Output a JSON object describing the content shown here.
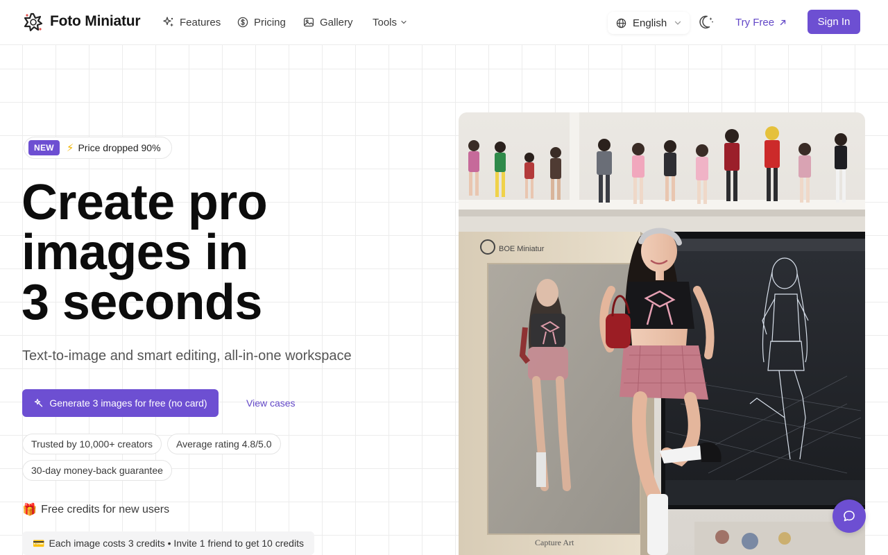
{
  "header": {
    "brand": "Foto Miniatur",
    "nav": [
      {
        "label": "Features",
        "icon": "sparkles-icon"
      },
      {
        "label": "Pricing",
        "icon": "dollar-circle-icon"
      },
      {
        "label": "Gallery",
        "icon": "image-icon"
      },
      {
        "label": "Tools",
        "icon": "chevron-down-icon"
      }
    ],
    "language": "English",
    "try_free": "Try Free",
    "sign_in": "Sign In"
  },
  "hero": {
    "badge_new": "NEW",
    "badge_bolt": "⚡",
    "badge_text": "Price dropped 90%",
    "title_lines": [
      "Create pro",
      "images in",
      "3 seconds"
    ],
    "subtitle": "Text-to-image and smart editing, all-in-one workspace",
    "cta": "Generate 3 images for free (no card)",
    "view_cases": "View cases",
    "chips": [
      "Trusted by 10,000+ creators",
      "Average rating 4.8/5.0",
      "30-day money-back guarantee"
    ],
    "free_credits_icon": "🎁",
    "free_credits": "Free credits for new users",
    "cost_icon": "💳",
    "cost_text": "Each image costs 3 credits • Invite 1 friend to get 10 credits"
  },
  "image": {
    "box_brand": "BOE Miniatur",
    "box_footer": "Capture Art"
  },
  "colors": {
    "accent": "#6d4fd2",
    "accent_text": "#6247c7"
  }
}
